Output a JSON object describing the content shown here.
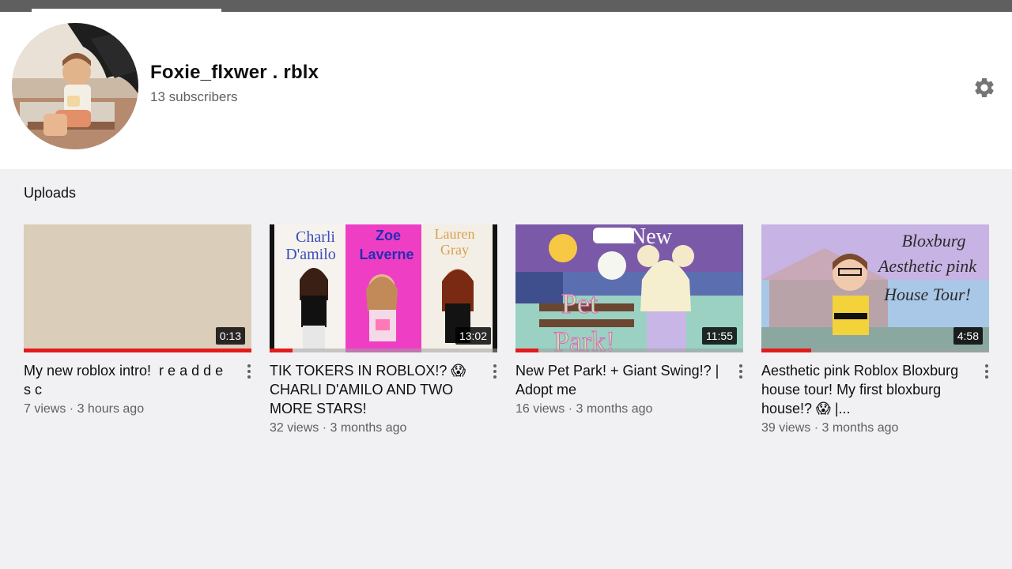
{
  "channel": {
    "name": "Foxie_flxwer . rblx",
    "subscribers": "13 subscribers",
    "settings_icon": "gear-icon"
  },
  "uploads": {
    "title": "Uploads",
    "videos": [
      {
        "title": "My new roblox intro!  r e a d d e s c",
        "views": "7 views",
        "age": "3 hours ago",
        "duration": "0:13",
        "watched": 1.0
      },
      {
        "title": "TIK TOKERS IN ROBLOX!? 😱 CHARLI D'AMILO AND TWO MORE STARS!",
        "views": "32 views",
        "age": "3 months ago",
        "duration": "13:02",
        "watched": 0.1,
        "thumb_text": {
          "charli": "Charli\nD'amilo",
          "zoe": "Zoe\nLaverne",
          "lauren": "Lauren\nGray"
        }
      },
      {
        "title": "New Pet Park! + Giant Swing!? | Adopt me",
        "views": "16 views",
        "age": "3 months ago",
        "duration": "11:55",
        "watched": 0.1,
        "thumb_text": {
          "new": "New",
          "pet": "Pet",
          "park": "Park!"
        }
      },
      {
        "title": "Aesthetic pink Roblox Bloxburg house tour! My first bloxburg house!? 😱 |...",
        "views": "39 views",
        "age": "3 months ago",
        "duration": "4:58",
        "watched": 0.22,
        "thumb_text": {
          "line1": "Bloxburg",
          "line2": "Aesthetic pink",
          "line3": "House Tour!"
        }
      }
    ]
  },
  "meta_separator": " · "
}
